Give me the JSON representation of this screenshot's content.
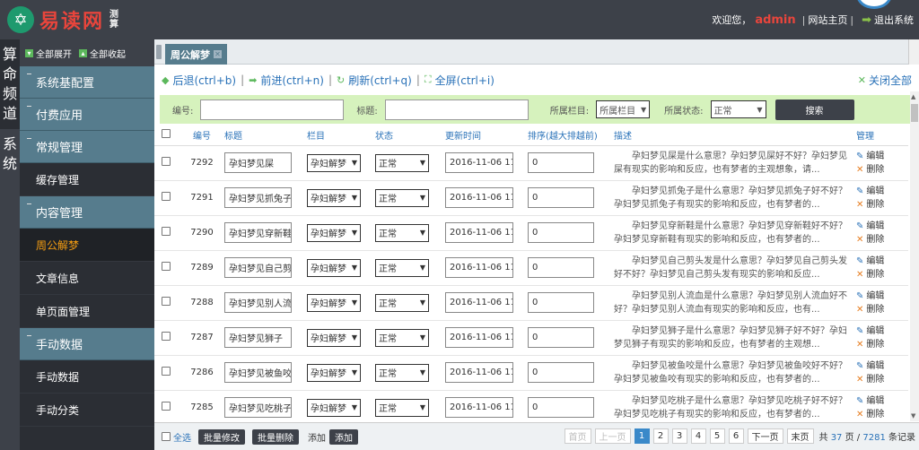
{
  "header": {
    "logo_text": "易读网",
    "logo_sub": "测算",
    "welcome": "欢迎您，",
    "username": "admin",
    "site_home": "网站主页",
    "logout": "退出系统"
  },
  "strip": {
    "items": [
      {
        "label": "算命频道"
      },
      {
        "label": "系统"
      }
    ]
  },
  "sidebar": {
    "expand_all": "全部展开",
    "collapse_all": "全部收起",
    "groups": [
      {
        "label": "系统基配置"
      },
      {
        "label": "付费应用"
      },
      {
        "label": "常规管理"
      },
      {
        "label": "缓存管理",
        "sub": true
      },
      {
        "label": "内容管理"
      },
      {
        "label": "周公解梦",
        "sub": true,
        "active": true
      },
      {
        "label": "文章信息",
        "sub": true
      },
      {
        "label": "单页面管理",
        "sub": true
      },
      {
        "label": "手动数据"
      },
      {
        "label": "手动数据",
        "sub": true
      },
      {
        "label": "手动分类",
        "sub": true
      }
    ]
  },
  "tabs": {
    "active": "周公解梦"
  },
  "toolbar": {
    "back": "后退(ctrl+b)",
    "forward": "前进(ctrl+n)",
    "refresh": "刷新(ctrl+q)",
    "fullscreen": "全屏(ctrl+i)",
    "close_all": "关闭全部"
  },
  "search": {
    "id_label": "编号:",
    "title_label": "标题:",
    "column_label": "所属栏目:",
    "column_value": "所属栏目",
    "status_label": "所属状态:",
    "status_value": "正常",
    "button": "搜索"
  },
  "table": {
    "headers": [
      "编号",
      "标题",
      "栏目",
      "状态",
      "更新时间",
      "排序(越大排越前)",
      "描述",
      "管理"
    ],
    "edit_label": "编辑",
    "delete_label": "删除",
    "rows": [
      {
        "id": "7292",
        "title": "孕妇梦见屎",
        "column": "孕妇解梦",
        "status": "正常",
        "time": "2016-11-06 11:",
        "sort": "0",
        "desc": "孕妇梦见屎是什么意思？孕妇梦见屎好不好？孕妇梦见屎有现实的影响和反应，也有梦者的主观想象，请..."
      },
      {
        "id": "7291",
        "title": "孕妇梦见抓兔子",
        "column": "孕妇解梦",
        "status": "正常",
        "time": "2016-11-06 11:",
        "sort": "0",
        "desc": "孕妇梦见抓兔子是什么意思？孕妇梦见抓兔子好不好？孕妇梦见抓兔子有现实的影响和反应，也有梦者的..."
      },
      {
        "id": "7290",
        "title": "孕妇梦见穿新鞋",
        "column": "孕妇解梦",
        "status": "正常",
        "time": "2016-11-06 11:",
        "sort": "0",
        "desc": "孕妇梦见穿新鞋是什么意思？孕妇梦见穿新鞋好不好？孕妇梦见穿新鞋有现实的影响和反应，也有梦者的..."
      },
      {
        "id": "7289",
        "title": "孕妇梦见自己剪",
        "column": "孕妇解梦",
        "status": "正常",
        "time": "2016-11-06 11:",
        "sort": "0",
        "desc": "孕妇梦见自己剪头发是什么意思？孕妇梦见自己剪头发好不好？孕妇梦见自己剪头发有现实的影响和反应..."
      },
      {
        "id": "7288",
        "title": "孕妇梦见别人流",
        "column": "孕妇解梦",
        "status": "正常",
        "time": "2016-11-06 11:",
        "sort": "0",
        "desc": "孕妇梦见别人流血是什么意思？孕妇梦见别人流血好不好？孕妇梦见别人流血有现实的影响和反应，也有..."
      },
      {
        "id": "7287",
        "title": "孕妇梦见狮子",
        "column": "孕妇解梦",
        "status": "正常",
        "time": "2016-11-06 11:",
        "sort": "0",
        "desc": "孕妇梦见狮子是什么意思？孕妇梦见狮子好不好？孕妇梦见狮子有现实的影响和反应，也有梦者的主观想..."
      },
      {
        "id": "7286",
        "title": "孕妇梦见被鱼咬",
        "column": "孕妇解梦",
        "status": "正常",
        "time": "2016-11-06 11:",
        "sort": "0",
        "desc": "孕妇梦见被鱼咬是什么意思？孕妇梦见被鱼咬好不好？孕妇梦见被鱼咬有现实的影响和反应，也有梦者的..."
      },
      {
        "id": "7285",
        "title": "孕妇梦见吃桃子",
        "column": "孕妇解梦",
        "status": "正常",
        "time": "2016-11-06 11:",
        "sort": "0",
        "desc": "孕妇梦见吃桃子是什么意思？孕妇梦见吃桃子好不好？孕妇梦见吃桃子有现实的影响和反应，也有梦者的..."
      }
    ]
  },
  "footer": {
    "select_all": "全选",
    "batch_edit": "批量修改",
    "batch_delete": "批量删除",
    "add_label": "添加",
    "add_button": "添加"
  },
  "pager": {
    "first": "首页",
    "prev": "上一页",
    "pages": [
      "1",
      "2",
      "3",
      "4",
      "5",
      "6"
    ],
    "current": "1",
    "next": "下一页",
    "last": "末页",
    "info_prefix": "共",
    "total_pages": "37",
    "info_mid": "页 /",
    "total_records": "7281",
    "info_suffix": "条记录"
  }
}
